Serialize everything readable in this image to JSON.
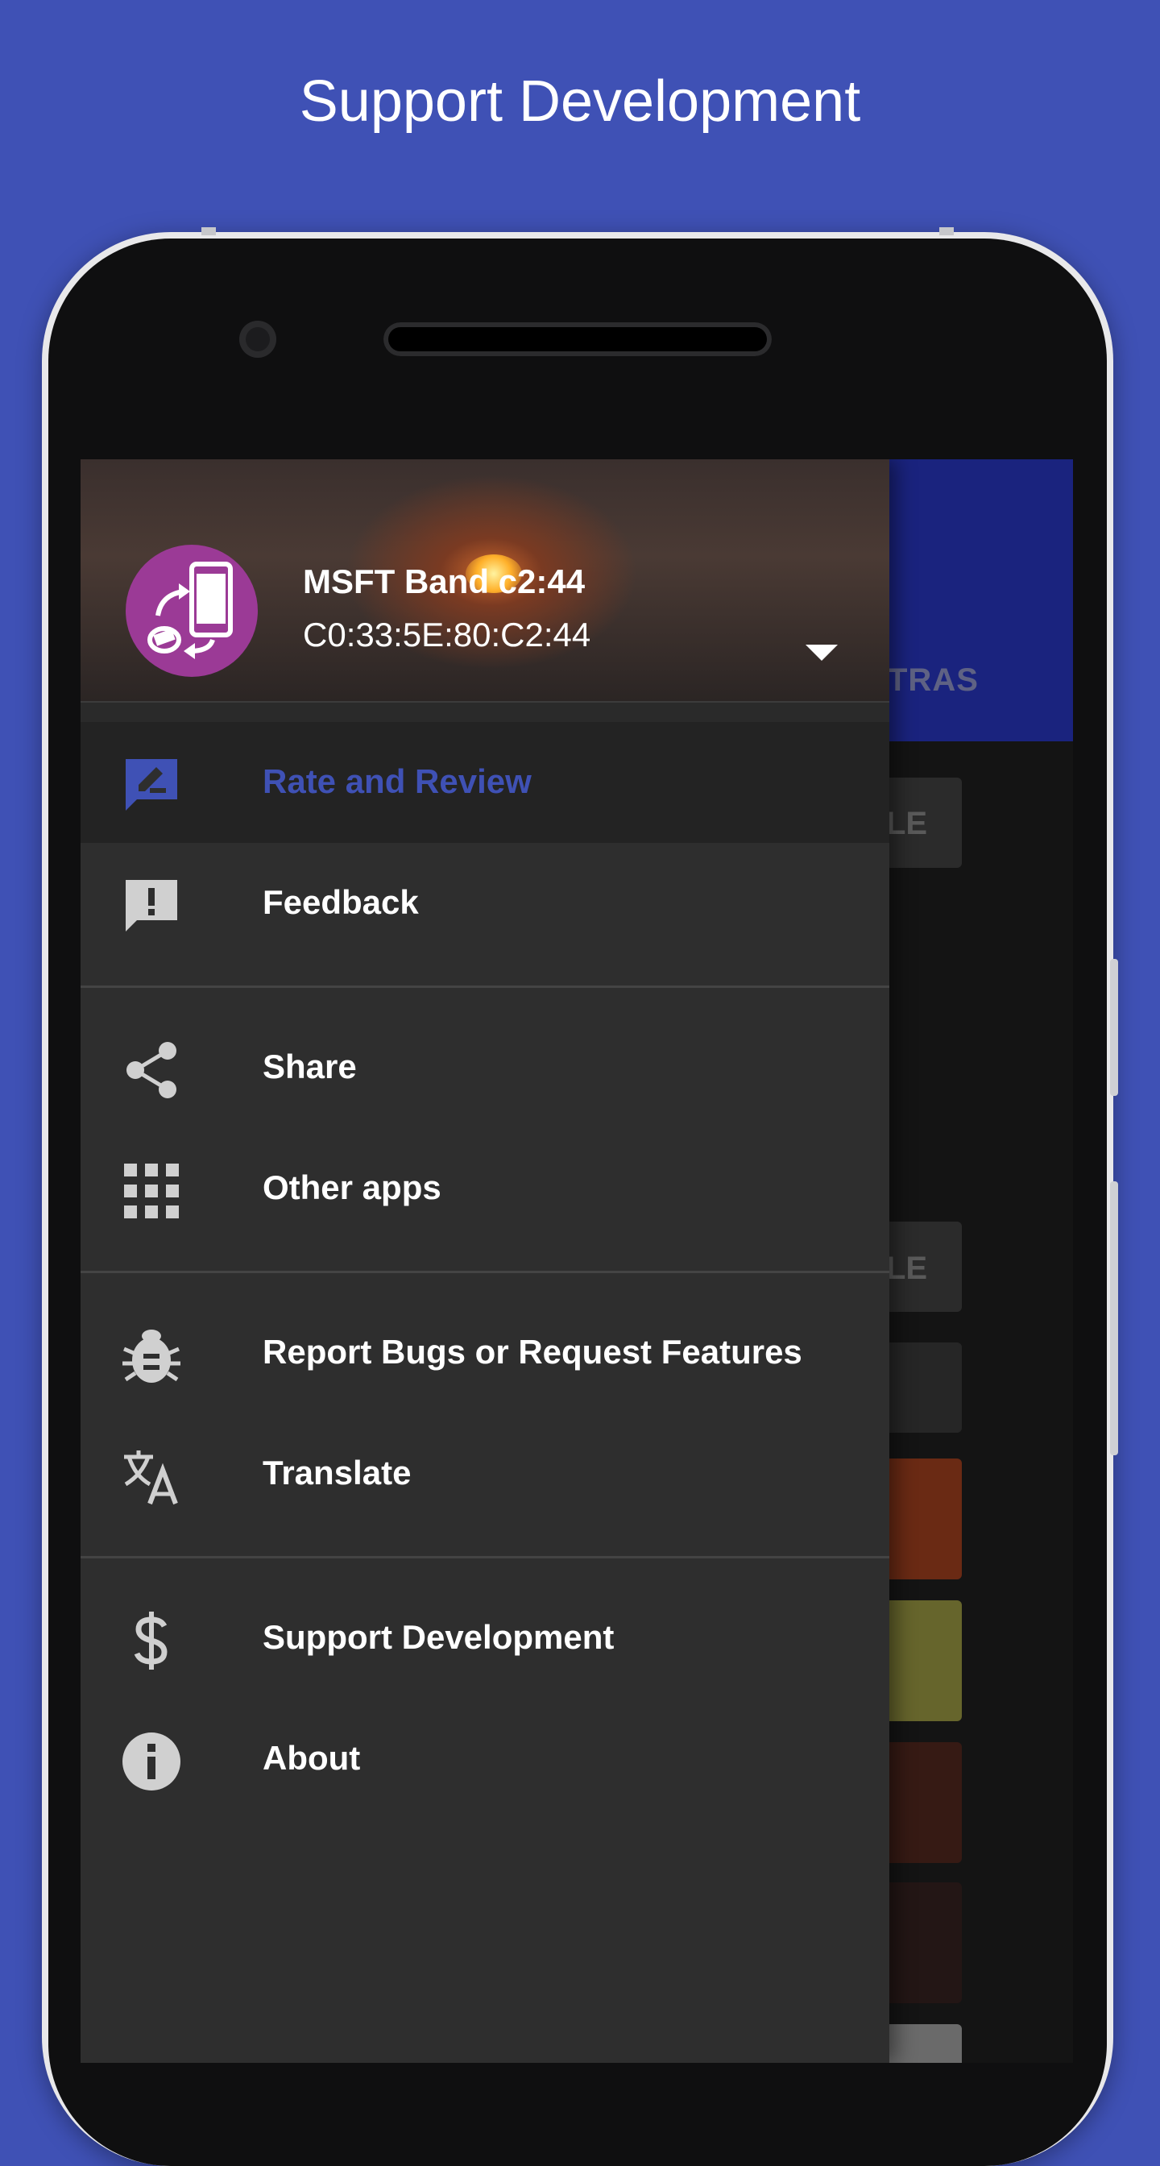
{
  "promo": {
    "title": "Support Development"
  },
  "colors": {
    "background": "#3f51b5",
    "accent": "#3f51b5",
    "drawer_bg": "#2e2e2e",
    "avatar_bg": "#9b3a96"
  },
  "background_app": {
    "tab_fragment": "TRAS",
    "button_fragment_1": "LE",
    "button_fragment_2": "LE"
  },
  "drawer": {
    "header": {
      "device_name": "MSFT Band c2:44",
      "device_mac": "C0:33:5E:80:C2:44",
      "avatar_icon": "phone-band-sync-icon",
      "dropdown_icon": "arrow-drop-down-icon"
    },
    "items": [
      {
        "label": "Rate and Review",
        "icon": "rate-review-icon",
        "active": true
      },
      {
        "label": "Feedback",
        "icon": "feedback-icon",
        "active": false
      },
      {
        "label": "Share",
        "icon": "share-icon",
        "active": false
      },
      {
        "label": "Other apps",
        "icon": "apps-grid-icon",
        "active": false
      },
      {
        "label": "Report Bugs or Request Features",
        "icon": "bug-icon",
        "active": false
      },
      {
        "label": "Translate",
        "icon": "translate-icon",
        "active": false
      },
      {
        "label": "Support Development",
        "icon": "dollar-icon",
        "active": false
      },
      {
        "label": "About",
        "icon": "info-icon",
        "active": false
      }
    ]
  }
}
